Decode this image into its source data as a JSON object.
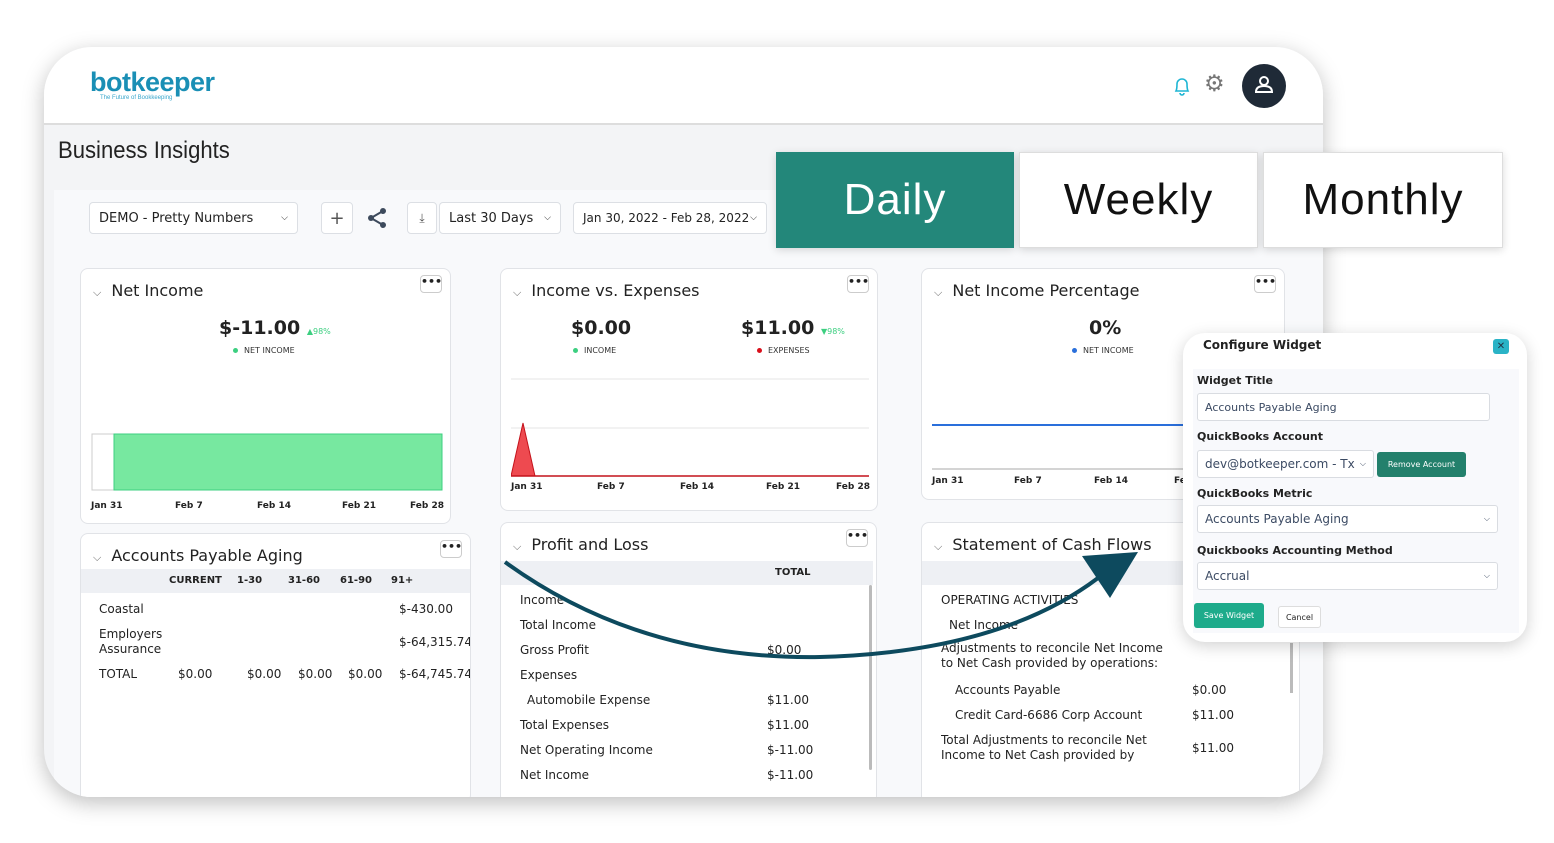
{
  "header": {
    "logo": "botkeeper",
    "tagline": "The Future of Bookkeeping",
    "icons": [
      "bell-icon",
      "gear-icon",
      "user-icon"
    ]
  },
  "page_title": "Business Insights",
  "toolbar": {
    "company": "DEMO - Pretty Numbers",
    "range": "Last 30 Days",
    "dates": "Jan 30, 2022 - Feb 28, 2022"
  },
  "tabs": [
    {
      "label": "Daily",
      "active": true
    },
    {
      "label": "Weekly"
    },
    {
      "label": "Monthly"
    }
  ],
  "accent": "#23877a",
  "net_income": {
    "title": "Net Income",
    "value": "$-11.00",
    "change": "▲98%",
    "legend": "NET INCOME"
  },
  "income_expenses": {
    "title": "Income vs. Expenses",
    "income": "$0.00",
    "income_label": "INCOME",
    "expenses": "$11.00",
    "change": "▼98%",
    "expenses_label": "EXPENSES"
  },
  "nip": {
    "title": "Net Income Percentage",
    "value": "0%",
    "legend": "NET INCOME"
  },
  "ticks": [
    "Jan 31",
    "Feb 7",
    "Feb 14",
    "Feb 21",
    "Feb 28"
  ],
  "ap": {
    "title": "Accounts Payable Aging",
    "headers": [
      "CURRENT",
      "1-30",
      "31-60",
      "61-90",
      "91+"
    ],
    "rows": [
      {
        "name": "Coastal",
        "v": [
          "",
          "",
          "",
          "",
          "$-430.00"
        ]
      },
      {
        "name": "Employers\nAssurance",
        "v": [
          "",
          "",
          "",
          "",
          "$-64,315.74"
        ]
      },
      {
        "name": "TOTAL",
        "v": [
          "$0.00",
          "$0.00",
          "$0.00",
          "$0.00",
          "$-64,745.74"
        ]
      }
    ]
  },
  "pl": {
    "title": "Profit and Loss",
    "header": "TOTAL",
    "rows": [
      {
        "l": "Income",
        "v": ""
      },
      {
        "l": "Total Income",
        "v": ""
      },
      {
        "l": "Gross Profit",
        "v": "$0.00"
      },
      {
        "l": "Expenses",
        "v": ""
      },
      {
        "l": "Automobile Expense",
        "v": "$11.00",
        "indent": true
      },
      {
        "l": "Total Expenses",
        "v": "$11.00"
      },
      {
        "l": "Net Operating Income",
        "v": "$-11.00"
      },
      {
        "l": "Net Income",
        "v": "$-11.00"
      }
    ]
  },
  "cf": {
    "title": "Statement of Cash Flows",
    "rows": [
      {
        "l": "OPERATING ACTIVITIES",
        "v": ""
      },
      {
        "l": "Net Income",
        "v": ""
      },
      {
        "l": "Adjustments to reconcile Net Income to Net Cash provided by operations:",
        "v": ""
      },
      {
        "l": "Accounts Payable",
        "v": "$0.00"
      },
      {
        "l": "Credit Card-6686 Corp Account",
        "v": "$11.00"
      },
      {
        "l": "Total Adjustments to reconcile Net Income to Net Cash provided by operations:",
        "v": "$11.00"
      }
    ]
  },
  "config": {
    "title": "Configure Widget",
    "widget_title_label": "Widget Title",
    "widget_title": "Accounts Payable Aging",
    "account_label": "QuickBooks Account",
    "account": "dev@botkeeper.com - TxM",
    "remove": "Remove Account",
    "metric_label": "QuickBooks Metric",
    "metric": "Accounts Payable Aging",
    "method_label": "Quickbooks Accounting Method",
    "method": "Accrual",
    "save": "Save Widget",
    "cancel": "Cancel"
  },
  "chart_data": [
    {
      "type": "area",
      "name": "Net Income",
      "x": [
        "Jan 30",
        "Jan 31",
        "Feb 28"
      ],
      "color": "#77e8a0"
    },
    {
      "type": "area",
      "name": "Income vs. Expenses",
      "series": [
        {
          "name": "EXPENSES",
          "x": [
            "Jan 30",
            "Jan 31",
            "Feb 1",
            "Feb 28"
          ],
          "values": [
            0,
            11,
            0,
            0
          ],
          "color": "#e8343a"
        },
        {
          "name": "INCOME",
          "values": [
            0,
            0,
            0,
            0
          ]
        }
      ]
    },
    {
      "type": "line",
      "name": "Net Income Percentage",
      "series": [
        {
          "name": "NET INCOME",
          "values": [
            0,
            0
          ],
          "color": "#2a6fdb"
        }
      ]
    }
  ]
}
